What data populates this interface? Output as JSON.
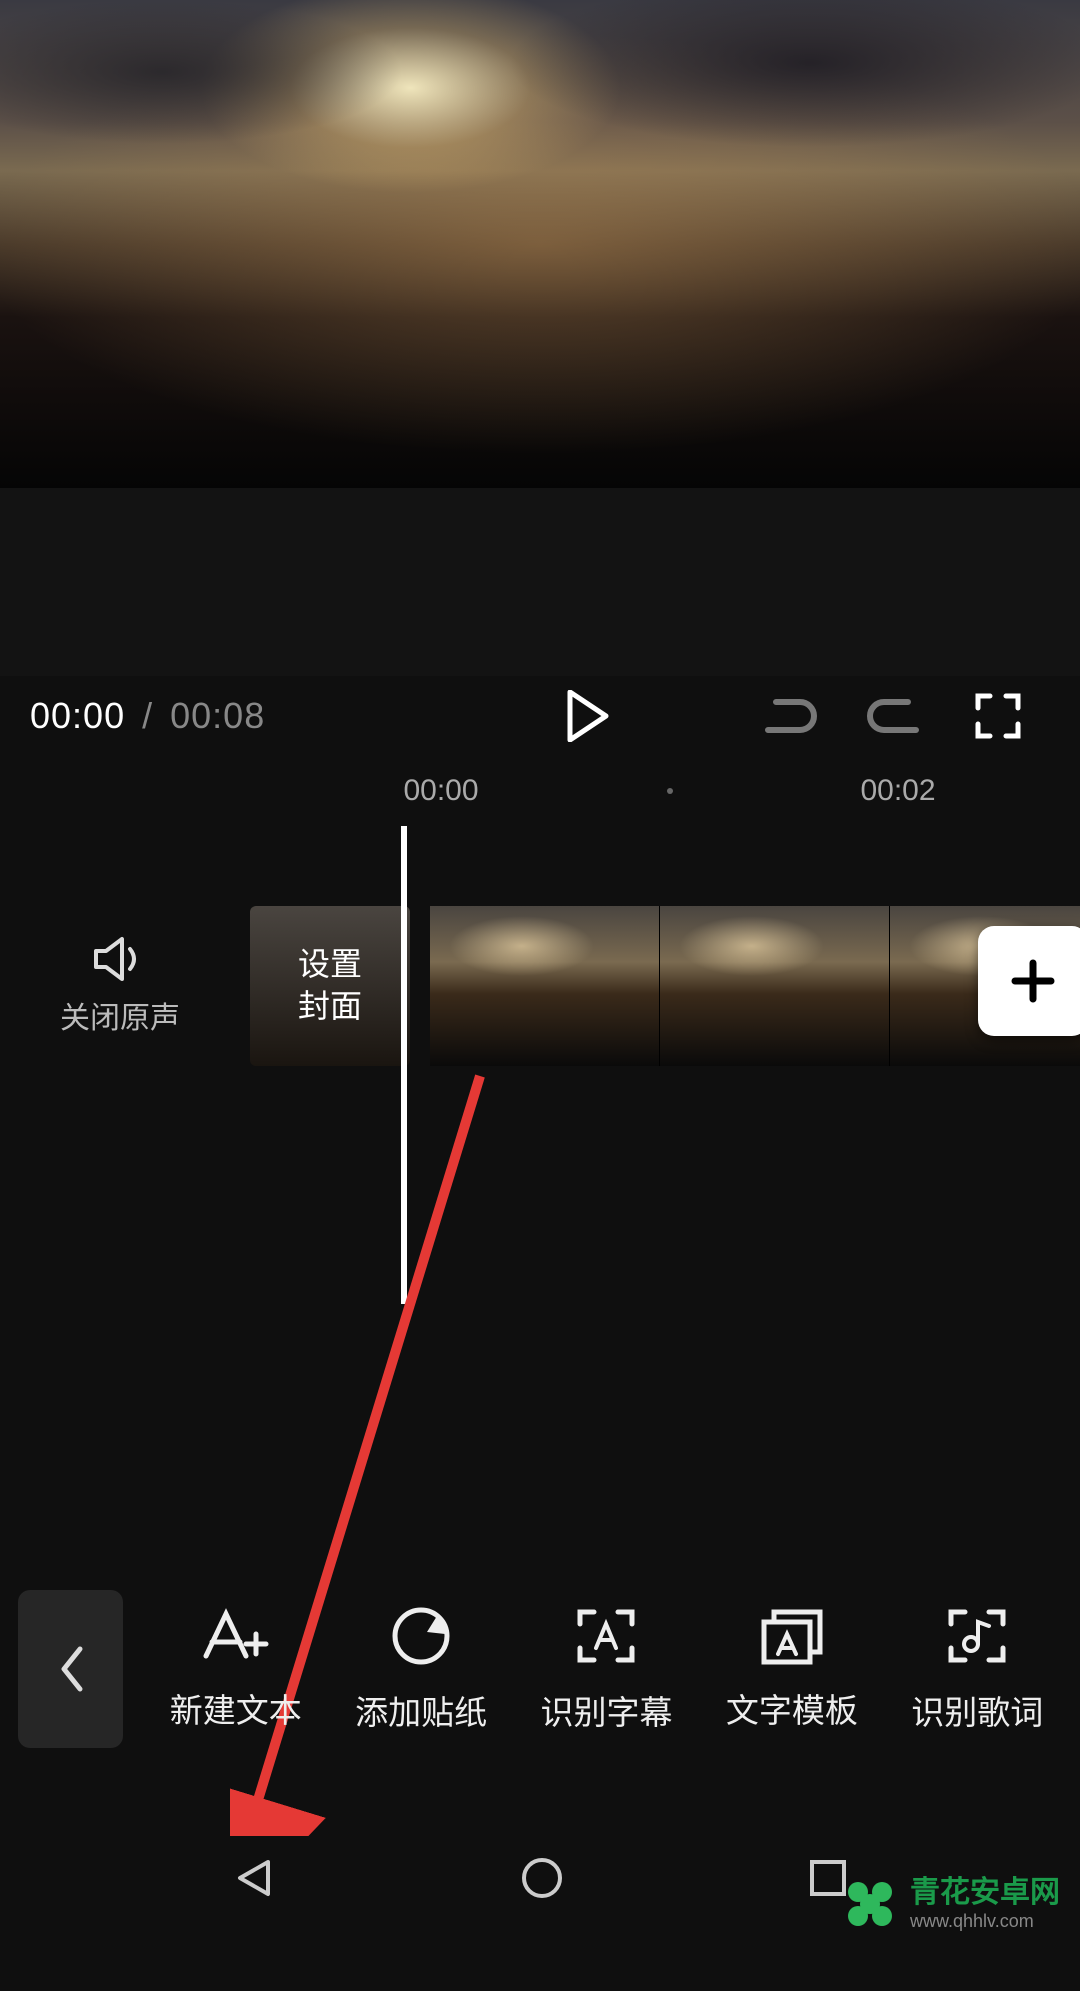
{
  "preview": {},
  "transport": {
    "current_time": "00:00",
    "separator": "/",
    "total_time": "00:08"
  },
  "ruler": {
    "marks": [
      "00:00",
      "00:02"
    ]
  },
  "timeline": {
    "mute_label": "关闭原声",
    "cover_line1": "设置",
    "cover_line2": "封面",
    "add_icon": "plus-icon"
  },
  "toolbar": {
    "back_icon": "chevron-left-icon",
    "items": [
      {
        "icon": "text-add-icon",
        "label": "新建文本"
      },
      {
        "icon": "sticker-icon",
        "label": "添加贴纸"
      },
      {
        "icon": "subtitle-icon",
        "label": "识别字幕"
      },
      {
        "icon": "text-template-icon",
        "label": "文字模板"
      },
      {
        "icon": "lyrics-icon",
        "label": "识别歌词"
      }
    ]
  },
  "watermark": {
    "title": "青花安卓网",
    "sub": "www.qhhlv.com"
  }
}
